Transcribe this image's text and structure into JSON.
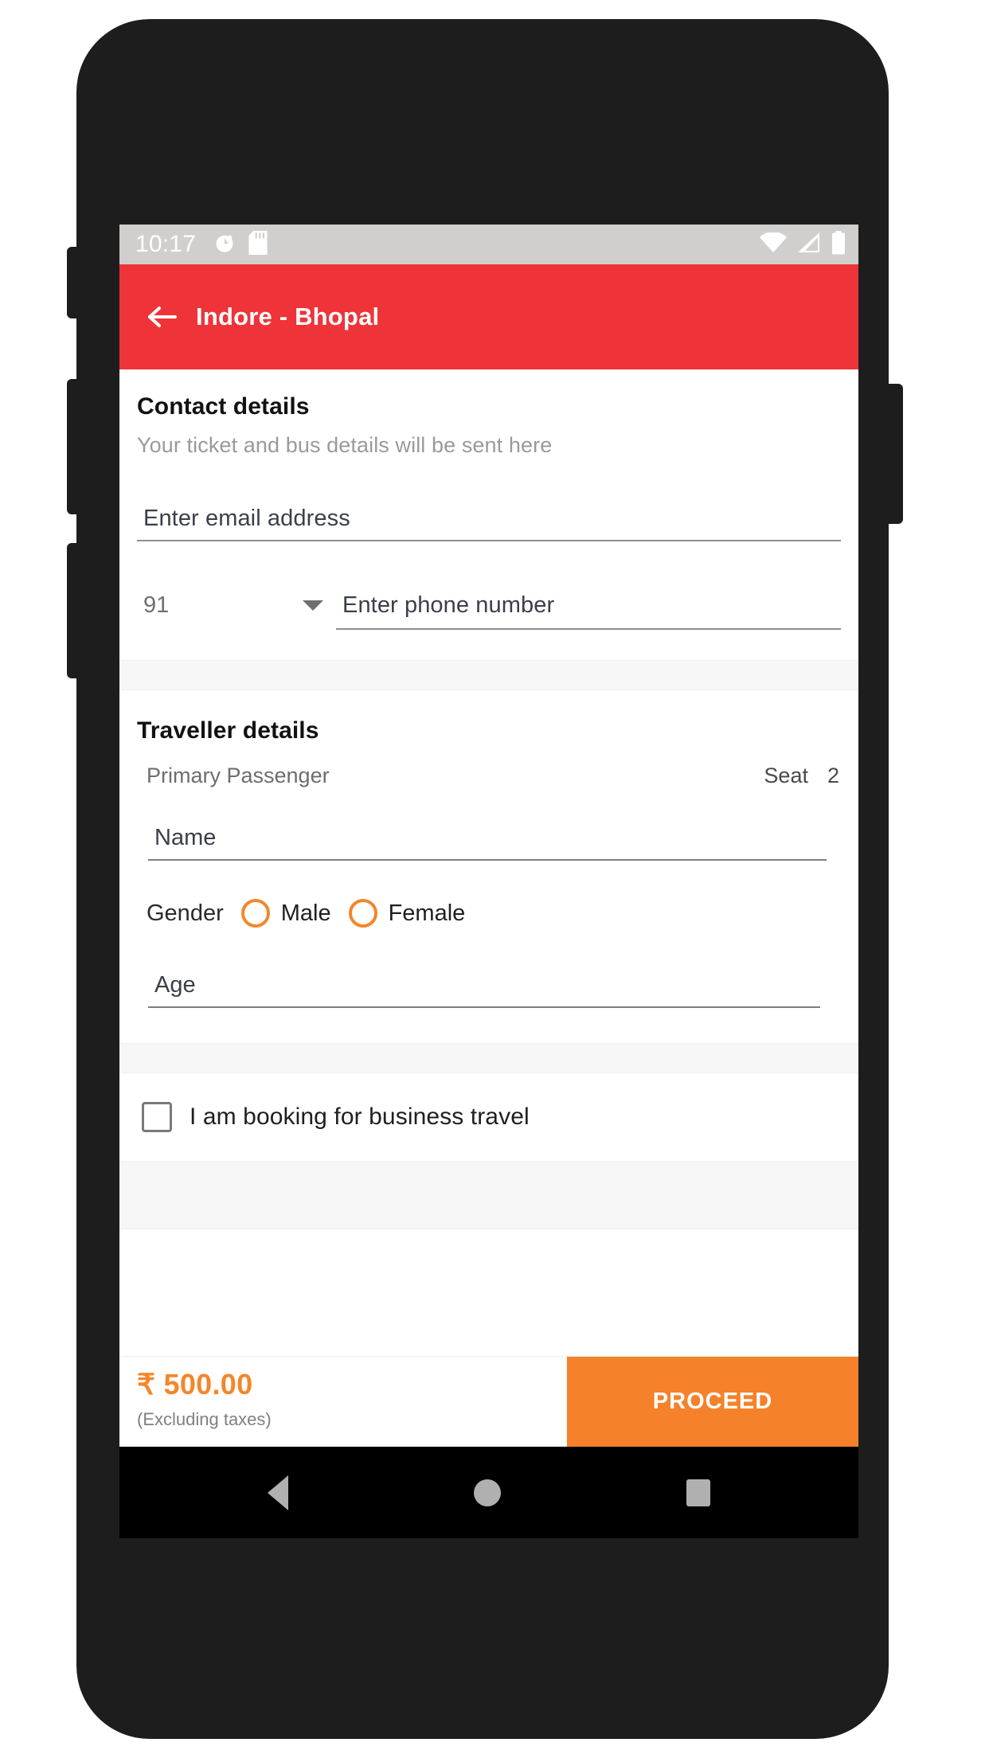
{
  "status_bar": {
    "time": "10:17",
    "left_icons": [
      "alarm-clock-icon",
      "sd-card-icon"
    ],
    "right_icons": [
      "wifi-icon",
      "cellular-signal-icon",
      "battery-icon"
    ]
  },
  "app_bar": {
    "back_icon": "back-arrow-icon",
    "title": "Indore - Bhopal",
    "background_color": "#EE3439"
  },
  "contact": {
    "title": "Contact details",
    "subtitle": "Your ticket and bus details will be sent here",
    "email_placeholder": "Enter email address",
    "email_value": "",
    "country_code": "91",
    "phone_placeholder": "Enter phone number",
    "phone_value": ""
  },
  "traveller": {
    "title": "Traveller details",
    "passenger_label": "Primary Passenger",
    "seat_label": "Seat",
    "seat_number": "2",
    "name_placeholder": "Name",
    "name_value": "",
    "gender_label": "Gender",
    "gender_options": [
      "Male",
      "Female"
    ],
    "gender_selected": "",
    "age_placeholder": "Age",
    "age_value": ""
  },
  "business": {
    "checkbox_label": "I am booking for business travel",
    "checked": false
  },
  "bottom_bar": {
    "price": "₹ 500.00",
    "price_note": "(Excluding taxes)",
    "proceed_label": "PROCEED",
    "accent_color": "#F5822A"
  },
  "nav_bar": {
    "back": "nav-back-icon",
    "home": "nav-home-icon",
    "recents": "nav-recents-icon"
  }
}
